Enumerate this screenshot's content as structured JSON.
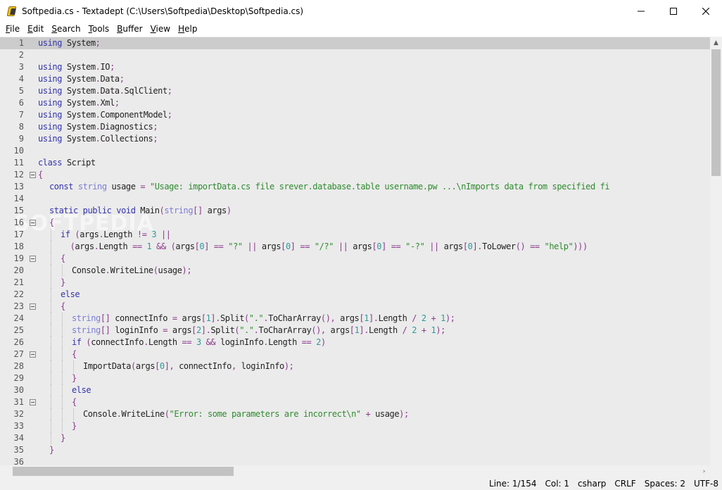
{
  "window": {
    "title": "Softpedia.cs - Textadept (C:\\Users\\Softpedia\\Desktop\\Softpedia.cs)",
    "minimize_glyph": "—",
    "maximize_glyph": "☐",
    "close_glyph": "✕"
  },
  "menu": [
    {
      "key": "F",
      "rest": "ile"
    },
    {
      "key": "E",
      "rest": "dit"
    },
    {
      "key": "S",
      "rest": "earch"
    },
    {
      "key": "T",
      "rest": "ools"
    },
    {
      "key": "B",
      "rest": "uffer"
    },
    {
      "key": "V",
      "rest": "iew"
    },
    {
      "key": "H",
      "rest": "elp"
    }
  ],
  "editor": {
    "current_line": 1,
    "watermark": "SOFTPEDIA",
    "lines": [
      {
        "n": "1",
        "fold": false,
        "indent": 0,
        "tokens": [
          [
            "kw",
            "using"
          ],
          [
            "",
            "System"
          ],
          [
            "op",
            ";"
          ]
        ]
      },
      {
        "n": "2",
        "fold": false,
        "indent": 0,
        "tokens": []
      },
      {
        "n": "3",
        "fold": false,
        "indent": 0,
        "tokens": [
          [
            "kw",
            "using"
          ],
          [
            "",
            "System"
          ],
          [
            "op",
            "."
          ],
          [
            "",
            "IO"
          ],
          [
            "op",
            ";"
          ]
        ]
      },
      {
        "n": "4",
        "fold": false,
        "indent": 0,
        "tokens": [
          [
            "kw",
            "using"
          ],
          [
            "",
            "System"
          ],
          [
            "op",
            "."
          ],
          [
            "",
            "Data"
          ],
          [
            "op",
            ";"
          ]
        ]
      },
      {
        "n": "5",
        "fold": false,
        "indent": 0,
        "tokens": [
          [
            "kw",
            "using"
          ],
          [
            "",
            "System"
          ],
          [
            "op",
            "."
          ],
          [
            "",
            "Data"
          ],
          [
            "op",
            "."
          ],
          [
            "",
            "SqlClient"
          ],
          [
            "op",
            ";"
          ]
        ]
      },
      {
        "n": "6",
        "fold": false,
        "indent": 0,
        "tokens": [
          [
            "kw",
            "using"
          ],
          [
            "",
            "System"
          ],
          [
            "op",
            "."
          ],
          [
            "",
            "Xml"
          ],
          [
            "op",
            ";"
          ]
        ]
      },
      {
        "n": "7",
        "fold": false,
        "indent": 0,
        "tokens": [
          [
            "kw",
            "using"
          ],
          [
            "",
            "System"
          ],
          [
            "op",
            "."
          ],
          [
            "",
            "ComponentModel"
          ],
          [
            "op",
            ";"
          ]
        ]
      },
      {
        "n": "8",
        "fold": false,
        "indent": 0,
        "tokens": [
          [
            "kw",
            "using"
          ],
          [
            "",
            "System"
          ],
          [
            "op",
            "."
          ],
          [
            "",
            "Diagnostics"
          ],
          [
            "op",
            ";"
          ]
        ]
      },
      {
        "n": "9",
        "fold": false,
        "indent": 0,
        "tokens": [
          [
            "kw",
            "using"
          ],
          [
            "",
            "System"
          ],
          [
            "op",
            "."
          ],
          [
            "",
            "Collections"
          ],
          [
            "op",
            ";"
          ]
        ]
      },
      {
        "n": "10",
        "fold": false,
        "indent": 0,
        "tokens": []
      },
      {
        "n": "11",
        "fold": false,
        "indent": 0,
        "tokens": [
          [
            "kw",
            "class"
          ],
          [
            "",
            " Script"
          ]
        ]
      },
      {
        "n": "12",
        "fold": true,
        "indent": 0,
        "tokens": [
          [
            "op",
            "{"
          ]
        ]
      },
      {
        "n": "13",
        "fold": false,
        "indent": 1,
        "tokens": [
          [
            "kw",
            "const"
          ],
          [
            "",
            " "
          ],
          [
            "ty",
            "string"
          ],
          [
            "",
            " usage "
          ],
          [
            "op",
            "="
          ],
          [
            "",
            " "
          ],
          [
            "str",
            "\"Usage: importData.cs file srever.database.table username.pw ...\\nImports data from specified fi"
          ]
        ]
      },
      {
        "n": "14",
        "fold": false,
        "indent": 1,
        "tokens": []
      },
      {
        "n": "15",
        "fold": false,
        "indent": 1,
        "tokens": [
          [
            "kw",
            "static"
          ],
          [
            "",
            " "
          ],
          [
            "kw",
            "public"
          ],
          [
            "",
            " "
          ],
          [
            "kw",
            "void"
          ],
          [
            "",
            " Main"
          ],
          [
            "op",
            "("
          ],
          [
            "ty",
            "string"
          ],
          [
            "op",
            "[]"
          ],
          [
            "",
            " args"
          ],
          [
            "op",
            ")"
          ]
        ]
      },
      {
        "n": "16",
        "fold": true,
        "indent": 1,
        "tokens": [
          [
            "op",
            "{"
          ]
        ]
      },
      {
        "n": "17",
        "fold": false,
        "indent": 2,
        "tokens": [
          [
            "kw",
            "if"
          ],
          [
            "",
            " "
          ],
          [
            "op",
            "("
          ],
          [
            "",
            "args"
          ],
          [
            "op",
            "."
          ],
          [
            "",
            "Length "
          ],
          [
            "op",
            "!="
          ],
          [
            "",
            " "
          ],
          [
            "num",
            "3"
          ],
          [
            "",
            " "
          ],
          [
            "op",
            "||"
          ]
        ]
      },
      {
        "n": "18",
        "fold": false,
        "indent": 2,
        "pad": "  ",
        "tokens": [
          [
            "op",
            "("
          ],
          [
            "",
            "args"
          ],
          [
            "op",
            "."
          ],
          [
            "",
            "Length "
          ],
          [
            "op",
            "=="
          ],
          [
            "",
            " "
          ],
          [
            "num",
            "1"
          ],
          [
            "",
            " "
          ],
          [
            "op",
            "&&"
          ],
          [
            "",
            " "
          ],
          [
            "op",
            "("
          ],
          [
            "",
            "args"
          ],
          [
            "op",
            "["
          ],
          [
            "num",
            "0"
          ],
          [
            "op",
            "]"
          ],
          [
            "",
            " "
          ],
          [
            "op",
            "=="
          ],
          [
            "",
            " "
          ],
          [
            "str",
            "\"?\""
          ],
          [
            "",
            " "
          ],
          [
            "op",
            "||"
          ],
          [
            "",
            " args"
          ],
          [
            "op",
            "["
          ],
          [
            "num",
            "0"
          ],
          [
            "op",
            "]"
          ],
          [
            "",
            " "
          ],
          [
            "op",
            "=="
          ],
          [
            "",
            " "
          ],
          [
            "str",
            "\"/?\""
          ],
          [
            "",
            " "
          ],
          [
            "op",
            "||"
          ],
          [
            "",
            " args"
          ],
          [
            "op",
            "["
          ],
          [
            "num",
            "0"
          ],
          [
            "op",
            "]"
          ],
          [
            "",
            " "
          ],
          [
            "op",
            "=="
          ],
          [
            "",
            " "
          ],
          [
            "str",
            "\"-?\""
          ],
          [
            "",
            " "
          ],
          [
            "op",
            "||"
          ],
          [
            "",
            " args"
          ],
          [
            "op",
            "["
          ],
          [
            "num",
            "0"
          ],
          [
            "op",
            "]."
          ],
          [
            "",
            "ToLower"
          ],
          [
            "op",
            "()"
          ],
          [
            "",
            " "
          ],
          [
            "op",
            "=="
          ],
          [
            "",
            " "
          ],
          [
            "str",
            "\"help\""
          ],
          [
            "op",
            ")))"
          ]
        ]
      },
      {
        "n": "19",
        "fold": true,
        "indent": 2,
        "tokens": [
          [
            "op",
            "{"
          ]
        ]
      },
      {
        "n": "20",
        "fold": false,
        "indent": 3,
        "tokens": [
          [
            "",
            "Console"
          ],
          [
            "op",
            "."
          ],
          [
            "",
            "WriteLine"
          ],
          [
            "op",
            "("
          ],
          [
            "",
            "usage"
          ],
          [
            "op",
            ");"
          ]
        ]
      },
      {
        "n": "21",
        "fold": false,
        "indent": 2,
        "tokens": [
          [
            "op",
            "}"
          ]
        ]
      },
      {
        "n": "22",
        "fold": false,
        "indent": 2,
        "tokens": [
          [
            "kw",
            "else"
          ]
        ]
      },
      {
        "n": "23",
        "fold": true,
        "indent": 2,
        "tokens": [
          [
            "op",
            "{"
          ]
        ]
      },
      {
        "n": "24",
        "fold": false,
        "indent": 3,
        "tokens": [
          [
            "ty",
            "string"
          ],
          [
            "op",
            "[]"
          ],
          [
            "",
            " connectInfo "
          ],
          [
            "op",
            "="
          ],
          [
            "",
            " args"
          ],
          [
            "op",
            "["
          ],
          [
            "num",
            "1"
          ],
          [
            "op",
            "]."
          ],
          [
            "",
            "Split"
          ],
          [
            "op",
            "("
          ],
          [
            "str",
            "\".\""
          ],
          [
            "op",
            "."
          ],
          [
            "",
            "ToCharArray"
          ],
          [
            "op",
            "(),"
          ],
          [
            "",
            " args"
          ],
          [
            "op",
            "["
          ],
          [
            "num",
            "1"
          ],
          [
            "op",
            "]."
          ],
          [
            "",
            "Length "
          ],
          [
            "op",
            "/"
          ],
          [
            "",
            " "
          ],
          [
            "num",
            "2"
          ],
          [
            "",
            " "
          ],
          [
            "op",
            "+"
          ],
          [
            "",
            " "
          ],
          [
            "num",
            "1"
          ],
          [
            "op",
            ");"
          ]
        ]
      },
      {
        "n": "25",
        "fold": false,
        "indent": 3,
        "tokens": [
          [
            "ty",
            "string"
          ],
          [
            "op",
            "[]"
          ],
          [
            "",
            " loginInfo "
          ],
          [
            "op",
            "="
          ],
          [
            "",
            " args"
          ],
          [
            "op",
            "["
          ],
          [
            "num",
            "2"
          ],
          [
            "op",
            "]."
          ],
          [
            "",
            "Split"
          ],
          [
            "op",
            "("
          ],
          [
            "str",
            "\".\""
          ],
          [
            "op",
            "."
          ],
          [
            "",
            "ToCharArray"
          ],
          [
            "op",
            "(),"
          ],
          [
            "",
            " args"
          ],
          [
            "op",
            "["
          ],
          [
            "num",
            "1"
          ],
          [
            "op",
            "]."
          ],
          [
            "",
            "Length "
          ],
          [
            "op",
            "/"
          ],
          [
            "",
            " "
          ],
          [
            "num",
            "2"
          ],
          [
            "",
            " "
          ],
          [
            "op",
            "+"
          ],
          [
            "",
            " "
          ],
          [
            "num",
            "1"
          ],
          [
            "op",
            ");"
          ]
        ]
      },
      {
        "n": "26",
        "fold": false,
        "indent": 3,
        "tokens": [
          [
            "kw",
            "if"
          ],
          [
            "",
            " "
          ],
          [
            "op",
            "("
          ],
          [
            "",
            "connectInfo"
          ],
          [
            "op",
            "."
          ],
          [
            "",
            "Length "
          ],
          [
            "op",
            "=="
          ],
          [
            "",
            " "
          ],
          [
            "num",
            "3"
          ],
          [
            "",
            " "
          ],
          [
            "op",
            "&&"
          ],
          [
            "",
            " loginInfo"
          ],
          [
            "op",
            "."
          ],
          [
            "",
            "Length "
          ],
          [
            "op",
            "=="
          ],
          [
            "",
            " "
          ],
          [
            "num",
            "2"
          ],
          [
            "op",
            ")"
          ]
        ]
      },
      {
        "n": "27",
        "fold": true,
        "indent": 3,
        "tokens": [
          [
            "op",
            "{"
          ]
        ]
      },
      {
        "n": "28",
        "fold": false,
        "indent": 4,
        "tokens": [
          [
            "",
            "ImportData"
          ],
          [
            "op",
            "("
          ],
          [
            "",
            "args"
          ],
          [
            "op",
            "["
          ],
          [
            "num",
            "0"
          ],
          [
            "op",
            "],"
          ],
          [
            "",
            " connectInfo"
          ],
          [
            "op",
            ","
          ],
          [
            "",
            " loginInfo"
          ],
          [
            "op",
            ");"
          ]
        ]
      },
      {
        "n": "29",
        "fold": false,
        "indent": 3,
        "tokens": [
          [
            "op",
            "}"
          ]
        ]
      },
      {
        "n": "30",
        "fold": false,
        "indent": 3,
        "tokens": [
          [
            "kw",
            "else"
          ]
        ]
      },
      {
        "n": "31",
        "fold": true,
        "indent": 3,
        "tokens": [
          [
            "op",
            "{"
          ]
        ]
      },
      {
        "n": "32",
        "fold": false,
        "indent": 4,
        "tokens": [
          [
            "",
            "Console"
          ],
          [
            "op",
            "."
          ],
          [
            "",
            "WriteLine"
          ],
          [
            "op",
            "("
          ],
          [
            "str",
            "\"Error: some parameters are incorrect\\n\""
          ],
          [
            "",
            " "
          ],
          [
            "op",
            "+"
          ],
          [
            "",
            " usage"
          ],
          [
            "op",
            ");"
          ]
        ]
      },
      {
        "n": "33",
        "fold": false,
        "indent": 3,
        "tokens": [
          [
            "op",
            "}"
          ]
        ]
      },
      {
        "n": "34",
        "fold": false,
        "indent": 2,
        "tokens": [
          [
            "op",
            "}"
          ]
        ]
      },
      {
        "n": "35",
        "fold": false,
        "indent": 1,
        "tokens": [
          [
            "op",
            "}"
          ]
        ]
      },
      {
        "n": "36",
        "fold": false,
        "indent": 1,
        "tokens": []
      }
    ]
  },
  "status": {
    "line": "Line: 1/154",
    "col": "Col: 1",
    "lexer": "csharp",
    "eol": "CRLF",
    "indent": "Spaces: 2",
    "encoding": "UTF-8"
  },
  "colors": {
    "keyword": "#3333aa",
    "type": "#7c7cd6",
    "string": "#2e8b2e",
    "number": "#2e9a9a",
    "operator": "#8b3a8b",
    "editor_bg": "#ebebeb",
    "current_line_bg": "#cccccc"
  }
}
